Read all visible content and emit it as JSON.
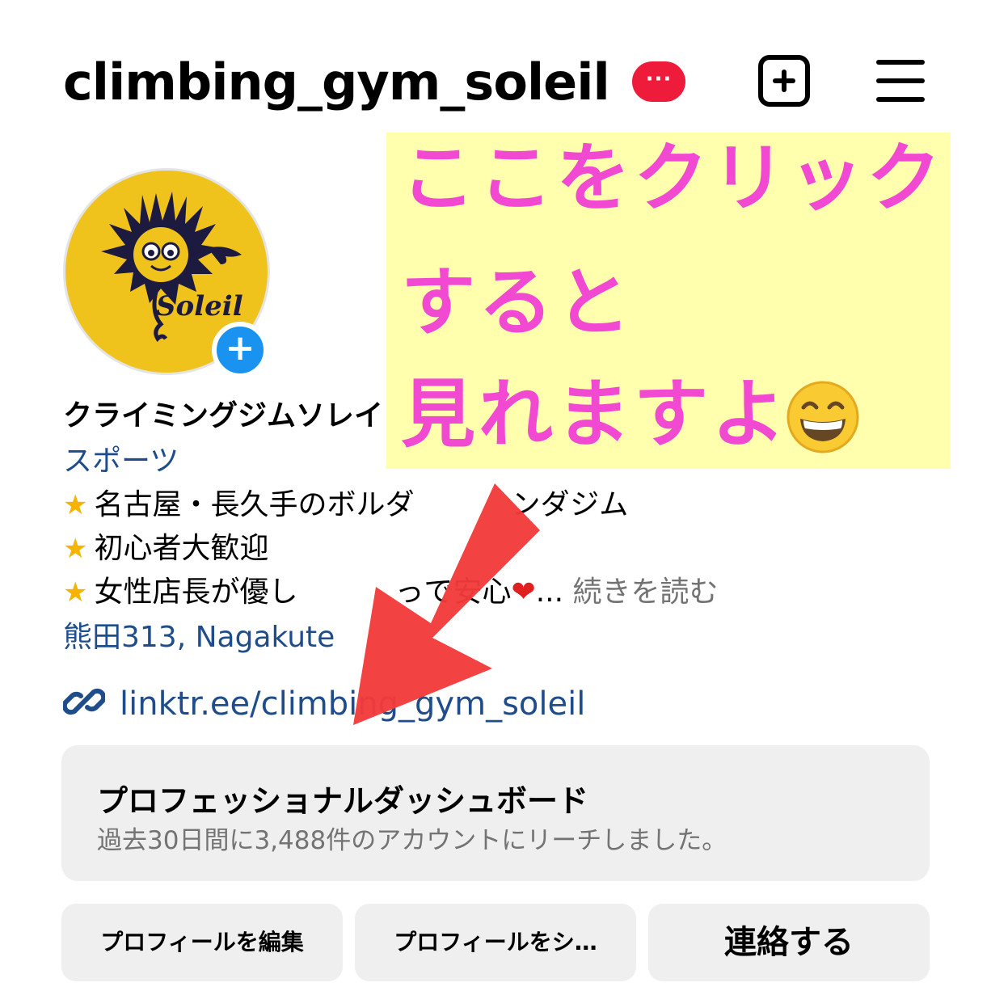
{
  "header": {
    "username": "climbing_gym_soleil",
    "notification_badge": "···"
  },
  "avatar": {
    "logo_text": "Soleil",
    "add_story_symbol": "+"
  },
  "profile": {
    "display_name": "クライミングジムソレイ",
    "category": "スポーツ",
    "bio_lines": [
      "名古屋・長久手のボルダ",
      "初心者大歓迎",
      "女性店長が優し"
    ],
    "bio_line_1_tail": "ンダジム",
    "bio_line_3_tail": "っで安心",
    "more_label": "続きを読む",
    "location": "熊田313, Nagakute",
    "link": "linktr.ee/climbing_gym_soleil"
  },
  "dashboard": {
    "title": "プロフェッショナルダッシュボード",
    "subtitle": "過去30日間に3,488件のアカウントにリーチしました。"
  },
  "actions": {
    "edit_label": "プロフィールを編集",
    "share_label": "プロフィールをシ…",
    "contact_label": "連絡する"
  },
  "annotation": {
    "line1": "ここをクリック",
    "line2": "すると",
    "line3": "見れますよ"
  },
  "colors": {
    "badge": "#ee1c3a",
    "link_blue": "#1f4d8c",
    "annotation_text": "#f23ccf",
    "annotation_bg": "#ffffa8",
    "arrow": "#f23a3a",
    "avatar_bg": "#f0c31c",
    "button_bg": "#efefef"
  },
  "icons": {
    "create": "plus-square-icon",
    "menu": "hamburger-menu-icon",
    "link": "chain-link-icon",
    "bio_bullet": "glowing-star-icon",
    "heart": "red-heart-icon",
    "annotation_emoji": "grinning-face-icon"
  }
}
